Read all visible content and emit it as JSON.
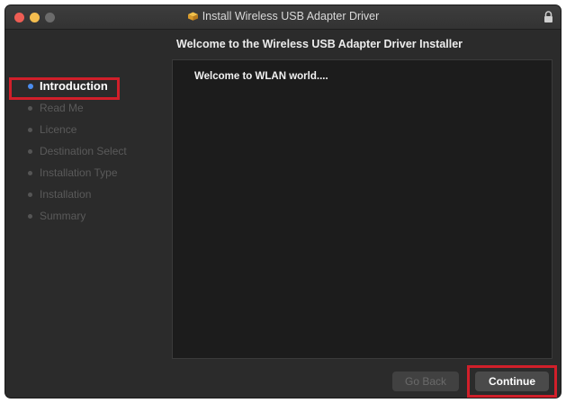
{
  "window": {
    "title": "Install Wireless USB Adapter Driver",
    "icons": {
      "title": "package-icon",
      "lock": "lock-icon"
    }
  },
  "heading": "Welcome to the Wireless USB Adapter Driver Installer",
  "sidebar": {
    "steps": [
      {
        "label": "Introduction",
        "active": true
      },
      {
        "label": "Read Me",
        "active": false
      },
      {
        "label": "Licence",
        "active": false
      },
      {
        "label": "Destination Select",
        "active": false
      },
      {
        "label": "Installation Type",
        "active": false
      },
      {
        "label": "Installation",
        "active": false
      },
      {
        "label": "Summary",
        "active": false
      }
    ]
  },
  "content": {
    "text": "Welcome to WLAN world...."
  },
  "buttons": {
    "back": "Go Back",
    "continue": "Continue"
  },
  "colors": {
    "highlight": "#d11f2a",
    "active_dot": "#4b8df0",
    "window_bg": "#2b2b2b"
  }
}
